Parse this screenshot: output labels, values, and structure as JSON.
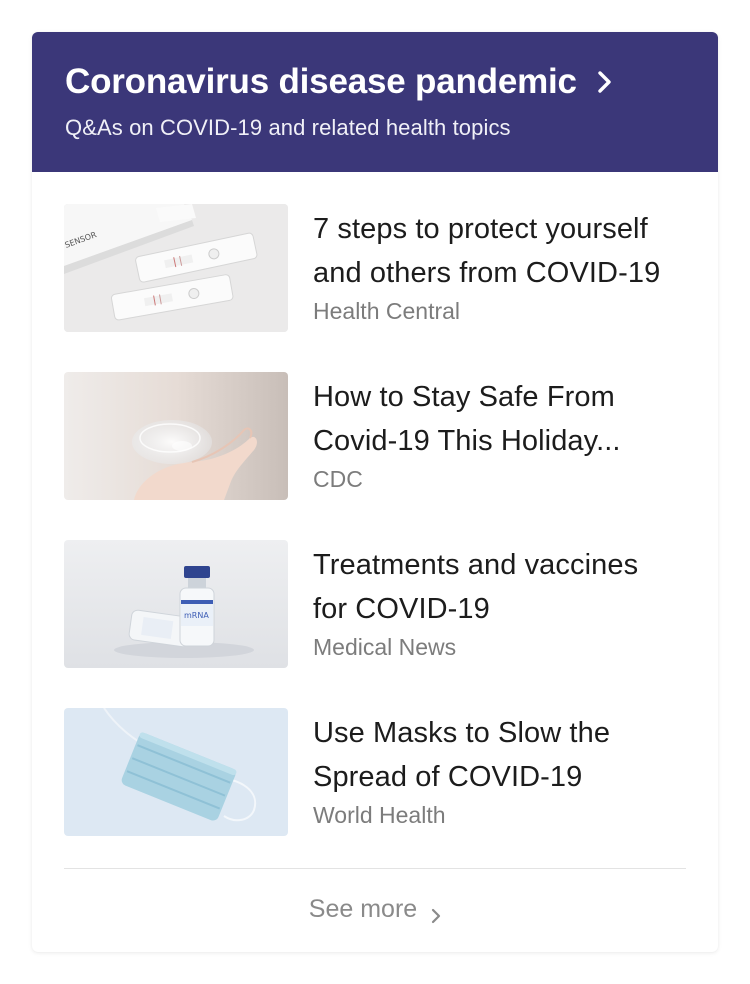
{
  "header": {
    "title": "Coronavirus disease pandemic",
    "subtitle": "Q&As on COVID-19 and related health topics",
    "background_color": "#3b3779",
    "chevron_icon": "chevron-right-icon"
  },
  "articles": [
    {
      "title_line1": "7 steps to protect yourself",
      "title_line2": "and others from COVID-19",
      "source": "Health Central",
      "thumbnail": "rapid-test-kit-image",
      "thumb_text": "SENSOR"
    },
    {
      "title_line1": "How to Stay Safe From",
      "title_line2": "Covid-19 This Holiday...",
      "source": "CDC",
      "thumbnail": "hand-sanitizer-gel-image"
    },
    {
      "title_line1": "Treatments and vaccines",
      "title_line2": "for COVID-19",
      "source": "Medical News",
      "thumbnail": "mrna-vaccine-vials-image",
      "thumb_text": "mRNA"
    },
    {
      "title_line1": "Use Masks to Slow the",
      "title_line2": "Spread of COVID-19",
      "source": "World Health",
      "thumbnail": "surgical-mask-image"
    }
  ],
  "footer": {
    "see_more_label": "See more",
    "chevron_icon": "chevron-right-icon"
  }
}
